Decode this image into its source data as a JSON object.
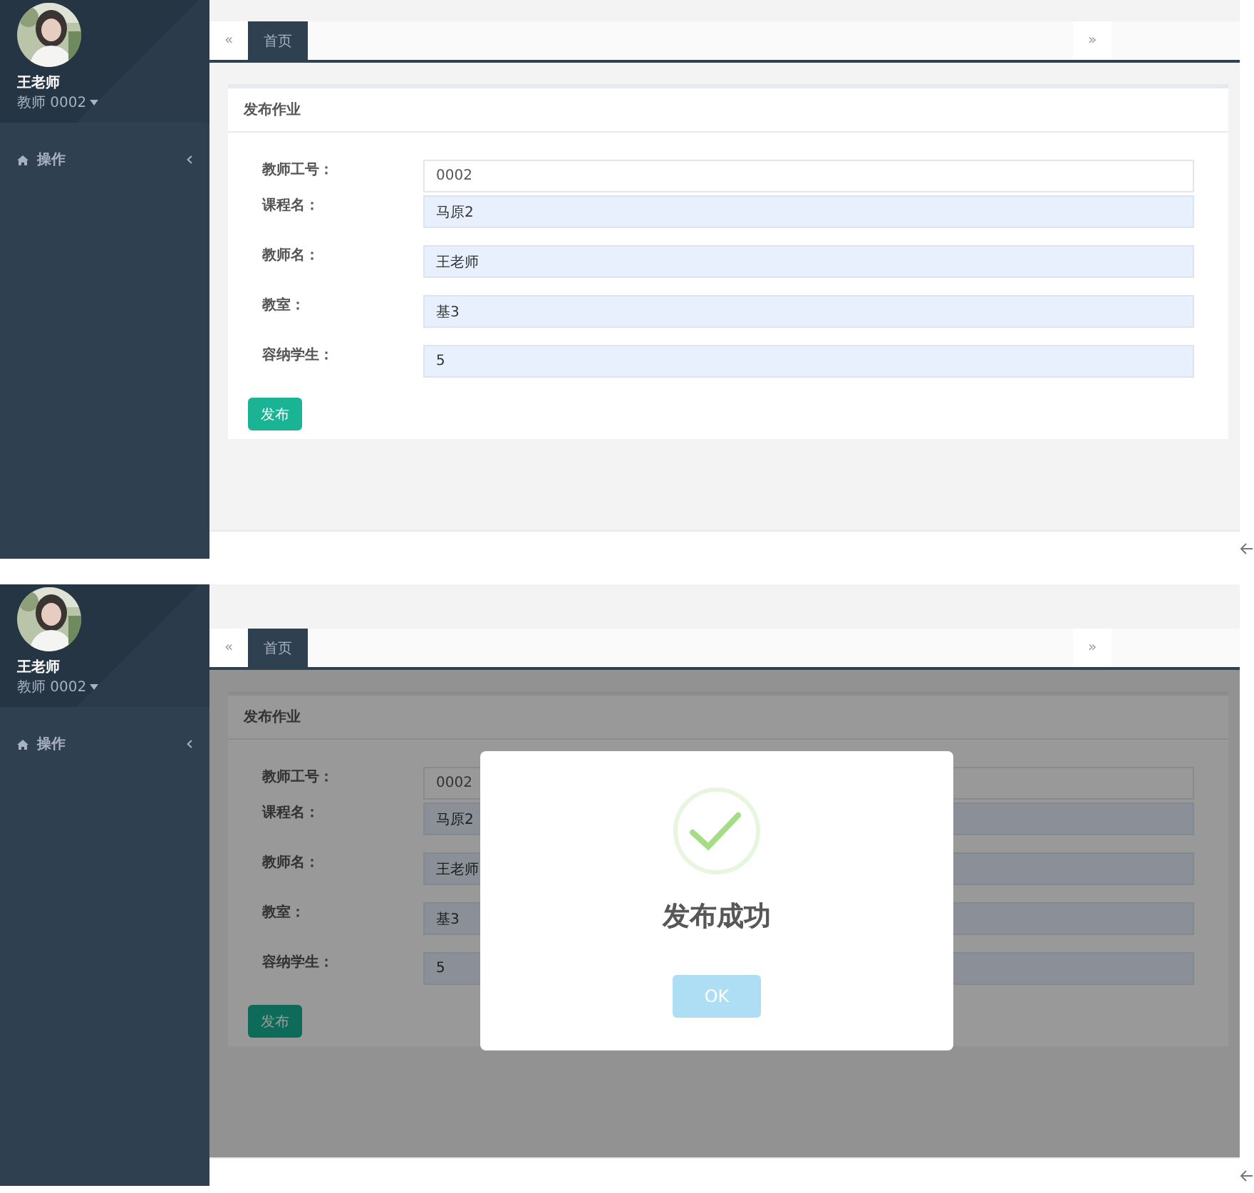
{
  "screens": [
    {
      "sidebar": {
        "user_name": "王老师",
        "user_role": "教师 0002",
        "menu": [
          {
            "label": "操作"
          }
        ]
      },
      "tabs": {
        "prev": "«",
        "items": [
          {
            "label": "首页",
            "selected": true
          }
        ],
        "next": "»"
      },
      "panel": {
        "title": "发布作业",
        "fields": [
          {
            "label": "教师工号：",
            "value": "0002",
            "autofilled": false
          },
          {
            "label": "课程名：",
            "value": "马原2",
            "autofilled": true
          },
          {
            "label": "教师名：",
            "value": "王老师",
            "autofilled": true
          },
          {
            "label": "教室：",
            "value": "基3",
            "autofilled": true
          },
          {
            "label": "容纳学生：",
            "value": "5",
            "autofilled": true
          }
        ],
        "submit": "发布"
      }
    },
    {
      "sidebar": {
        "user_name": "王老师",
        "user_role": "教师 0002",
        "menu": [
          {
            "label": "操作"
          }
        ]
      },
      "tabs": {
        "prev": "«",
        "items": [
          {
            "label": "首页",
            "selected": true
          }
        ],
        "next": "»"
      },
      "panel": {
        "title": "发布作业",
        "fields": [
          {
            "label": "教师工号：",
            "value": "0002",
            "autofilled": false
          },
          {
            "label": "课程名：",
            "value": "马原2",
            "autofilled": true
          },
          {
            "label": "教师名：",
            "value": "王老师",
            "autofilled": true
          },
          {
            "label": "教室：",
            "value": "基3",
            "autofilled": true
          },
          {
            "label": "容纳学生：",
            "value": "5",
            "autofilled": true
          }
        ],
        "submit": "发布"
      },
      "dialog": {
        "title": "发布成功",
        "button": "OK"
      }
    }
  ]
}
